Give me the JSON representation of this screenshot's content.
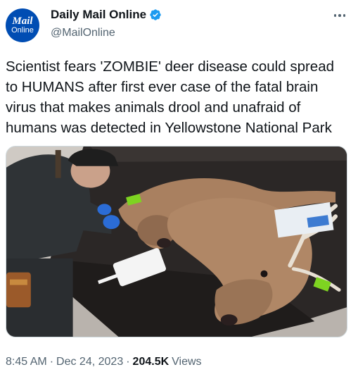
{
  "account": {
    "avatar_line1": "Mail",
    "avatar_line2": "Online",
    "display_name": "Daily Mail Online",
    "handle": "@MailOnline",
    "verified": true
  },
  "tweet": {
    "text": "Scientist fears 'ZOMBIE' deer disease could spread\nto HUMANS after first ever case of the fatal brain\nvirus that makes animals drool and unafraid of\nhumans was detected in Yellowstone National Park",
    "media_description_icon": "photo"
  },
  "meta": {
    "time": "8:45 AM",
    "separator1": "·",
    "date": "Dec 24, 2023",
    "separator2": "·",
    "views_count": "204.5K",
    "views_label": "Views"
  },
  "colors": {
    "brand": "#004db3",
    "verified": "#1d9bf0",
    "muted": "#536471",
    "text": "#0f1419"
  }
}
